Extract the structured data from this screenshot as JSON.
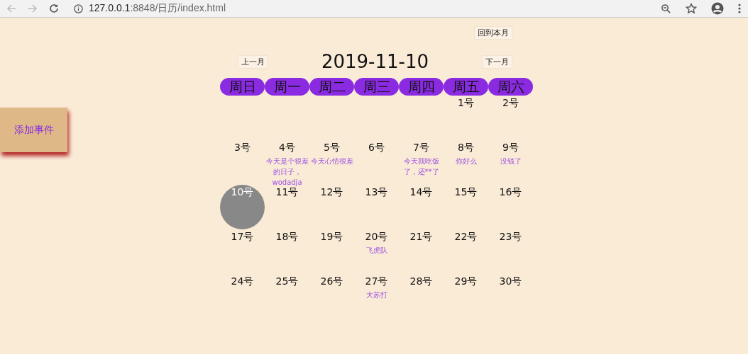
{
  "browser": {
    "url_host": "127.0.0.1",
    "url_rest": ":8848/日历/index.html"
  },
  "add_event_button": "添加事件",
  "back_to_month_button": "回到本月",
  "prev_month_button": "上一月",
  "current_date": "2019-11-10",
  "next_month_button": "下一月",
  "weekdays": [
    "周日",
    "周一",
    "周二",
    "周三",
    "周四",
    "周五",
    "周六"
  ],
  "weeks": [
    [
      {
        "kind": "blank"
      },
      {
        "kind": "blank"
      },
      {
        "kind": "blank"
      },
      {
        "kind": "blank"
      },
      {
        "kind": "blank"
      },
      {
        "kind": "day",
        "label": "1号",
        "selected": false
      },
      {
        "kind": "day",
        "label": "2号",
        "selected": false
      }
    ],
    [
      {
        "kind": "day",
        "label": "3号",
        "selected": false
      },
      {
        "kind": "day",
        "label": "4号",
        "selected": false,
        "event": "今天是个很差的日子，wodadja"
      },
      {
        "kind": "day",
        "label": "5号",
        "selected": false,
        "event": "今天心情很差"
      },
      {
        "kind": "day",
        "label": "6号",
        "selected": false
      },
      {
        "kind": "day",
        "label": "7号",
        "selected": false,
        "event": "今天我吃饭了，还**了"
      },
      {
        "kind": "day",
        "label": "8号",
        "selected": false,
        "event": "你好么"
      },
      {
        "kind": "day",
        "label": "9号",
        "selected": false,
        "event": "没钱了"
      }
    ],
    [
      {
        "kind": "day",
        "label": "10号",
        "selected": true
      },
      {
        "kind": "day",
        "label": "11号",
        "selected": false
      },
      {
        "kind": "day",
        "label": "12号",
        "selected": false
      },
      {
        "kind": "day",
        "label": "13号",
        "selected": false
      },
      {
        "kind": "day",
        "label": "14号",
        "selected": false
      },
      {
        "kind": "day",
        "label": "15号",
        "selected": false
      },
      {
        "kind": "day",
        "label": "16号",
        "selected": false
      }
    ],
    [
      {
        "kind": "day",
        "label": "17号",
        "selected": false
      },
      {
        "kind": "day",
        "label": "18号",
        "selected": false
      },
      {
        "kind": "day",
        "label": "19号",
        "selected": false
      },
      {
        "kind": "day",
        "label": "20号",
        "selected": false,
        "event": "飞虎队"
      },
      {
        "kind": "day",
        "label": "21号",
        "selected": false
      },
      {
        "kind": "day",
        "label": "22号",
        "selected": false
      },
      {
        "kind": "day",
        "label": "23号",
        "selected": false
      }
    ],
    [
      {
        "kind": "day",
        "label": "24号",
        "selected": false
      },
      {
        "kind": "day",
        "label": "25号",
        "selected": false
      },
      {
        "kind": "day",
        "label": "26号",
        "selected": false
      },
      {
        "kind": "day",
        "label": "27号",
        "selected": false,
        "event": "大苏打"
      },
      {
        "kind": "day",
        "label": "28号",
        "selected": false
      },
      {
        "kind": "day",
        "label": "29号",
        "selected": false
      },
      {
        "kind": "day",
        "label": "30号",
        "selected": false
      }
    ]
  ]
}
